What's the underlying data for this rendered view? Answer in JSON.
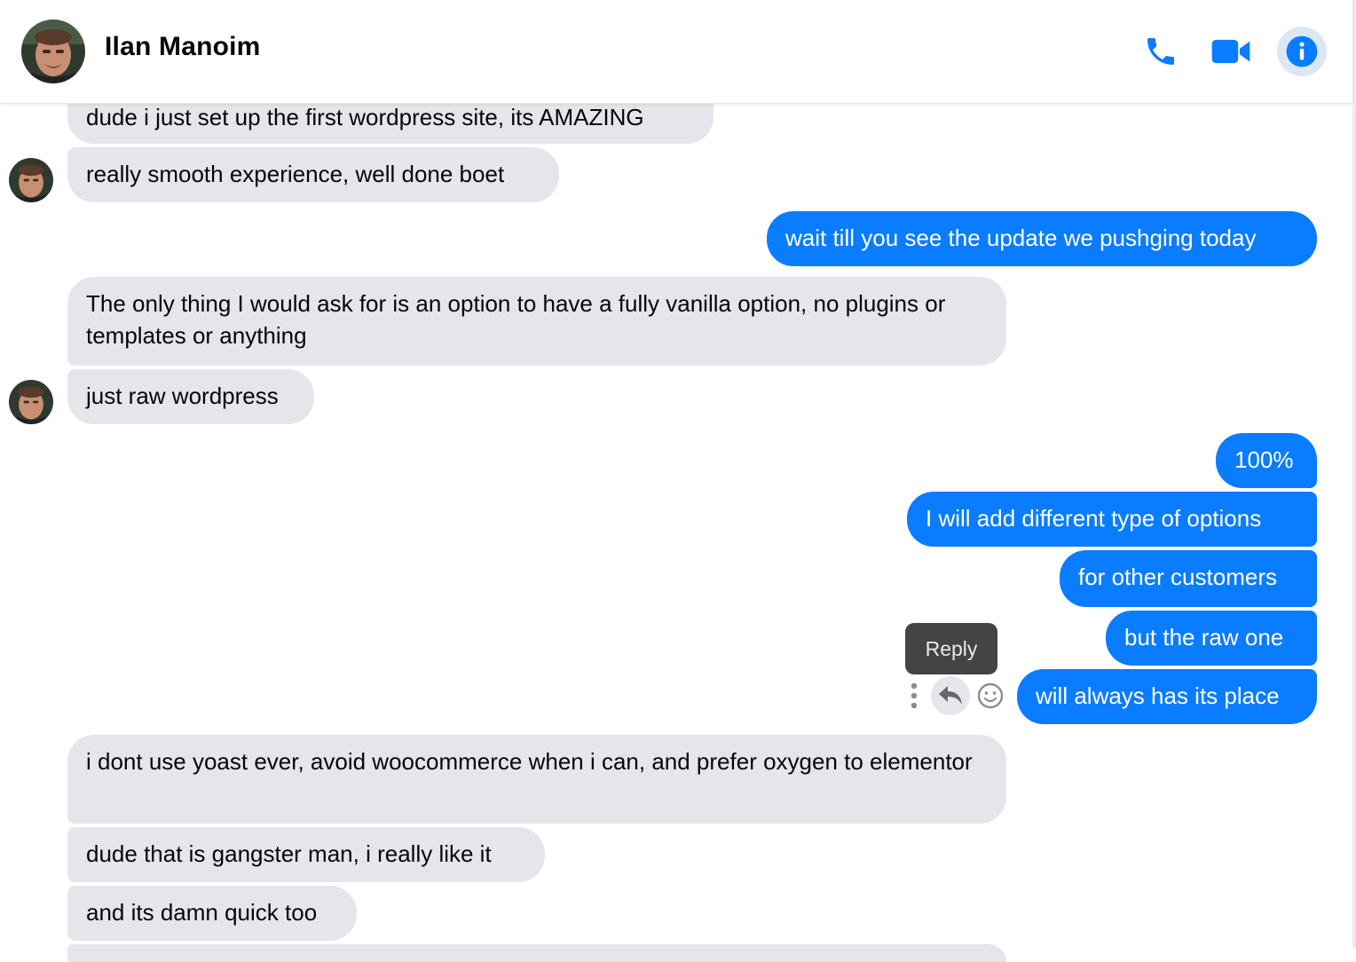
{
  "header": {
    "contact_name": "Ilan Manoim",
    "icons": [
      "phone-icon",
      "video-camera-icon",
      "info-icon"
    ],
    "accent_color": "#0a7cff"
  },
  "messages": [
    {
      "side": "in",
      "text": "dude i just set up the first wordpress site, its AMAZING"
    },
    {
      "side": "in",
      "text": "really smooth experience, well done boet"
    },
    {
      "side": "out",
      "text": "wait till you see the update we pushging today"
    },
    {
      "side": "in",
      "text": "The only thing I would ask for is an option to have a fully vanilla option, no plugins or templates or anything"
    },
    {
      "side": "in",
      "text": "just raw wordpress"
    },
    {
      "side": "out",
      "text": "100%"
    },
    {
      "side": "out",
      "text": "I will add different type of options"
    },
    {
      "side": "out",
      "text": "for other customers"
    },
    {
      "side": "out",
      "text": "but the raw one"
    },
    {
      "side": "out",
      "text": "will always has its place"
    },
    {
      "side": "in",
      "text": "i dont use yoast ever, avoid woocommerce when i can, and prefer oxygen to elementor"
    },
    {
      "side": "in",
      "text": "dude that is gangster man, i really like it"
    },
    {
      "side": "in",
      "text": "and its damn quick too"
    }
  ],
  "hover_actions": {
    "tooltip": "Reply",
    "icons": [
      "more-options-icon",
      "reply-icon",
      "react-emoji-icon"
    ]
  },
  "colors": {
    "incoming_bubble": "#e4e6eb",
    "outgoing_bubble": "#0a7cff"
  }
}
